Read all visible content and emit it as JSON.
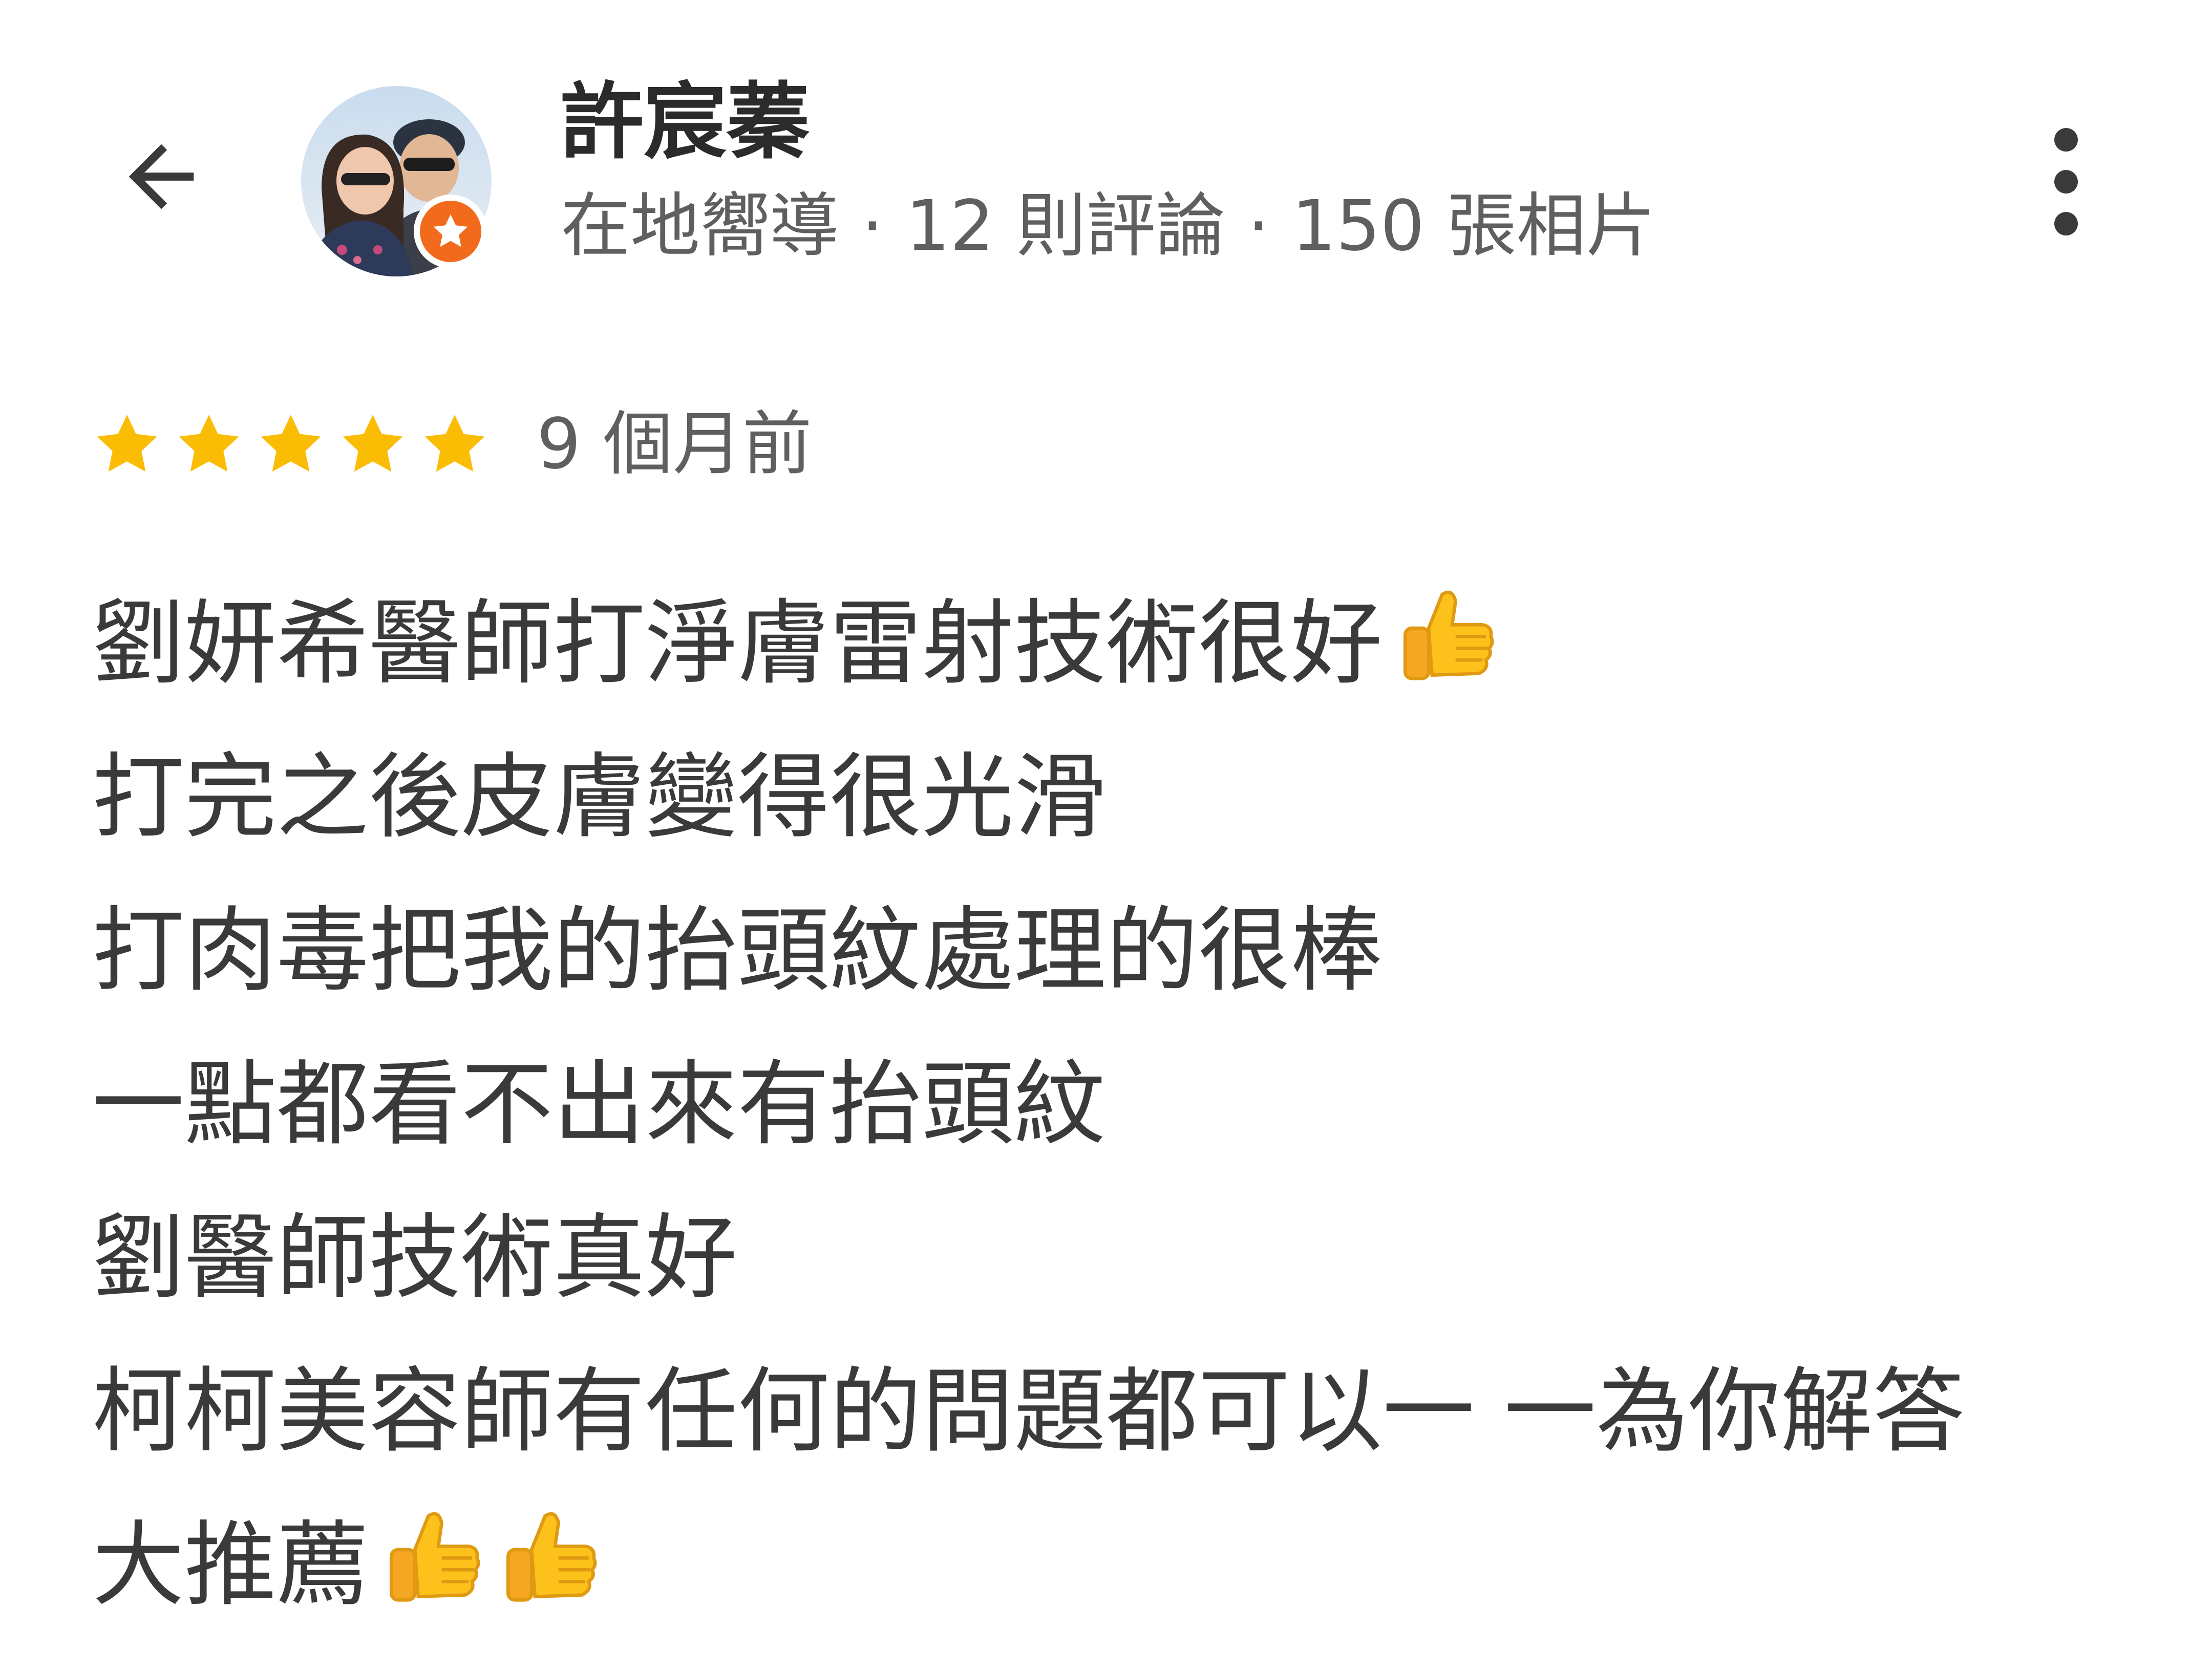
{
  "header": {
    "user_name": "許宸蓁",
    "user_meta": "在地嚮導 · 12 則評論 · 150 張相片"
  },
  "icons": {
    "back": "arrow-left-icon",
    "more": "more-vert-icon",
    "badge": "local-guide-star-icon",
    "rating_star": "star-icon",
    "emoji": "thumbs-up-emoji"
  },
  "colors": {
    "star": "#fbbc04",
    "badge": "#f26b1d",
    "thumb": "#fcc21b"
  },
  "review": {
    "rating": 5,
    "max_rating": 5,
    "timestamp": "9 個月前",
    "lines": [
      {
        "text": "劉妍希醫師打淨膚雷射技術很好",
        "emoji_count": 1
      },
      {
        "text": "打完之後皮膚變得很光滑",
        "emoji_count": 0
      },
      {
        "text": "打肉毒把我的抬頭紋處理的很棒",
        "emoji_count": 0
      },
      {
        "text": "一點都看不出來有抬頭紋",
        "emoji_count": 0
      },
      {
        "text": "劉醫師技術真好",
        "emoji_count": 0
      },
      {
        "text": "柯柯美容師有任何的問題都可以一 一為你解答",
        "emoji_count": 0
      },
      {
        "text": "大推薦",
        "emoji_count": 2
      }
    ]
  }
}
